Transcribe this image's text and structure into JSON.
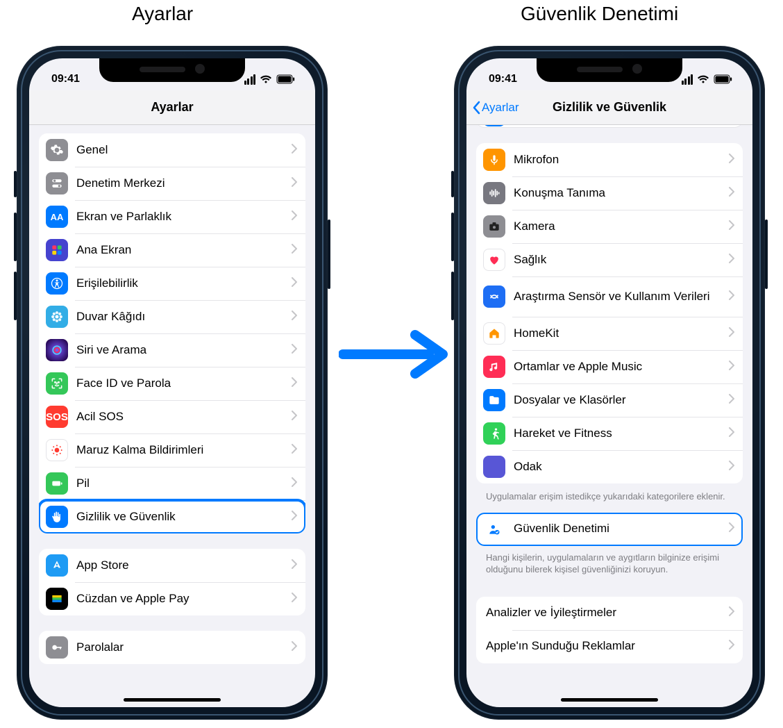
{
  "headings": {
    "left": "Ayarlar",
    "right": "Güvenlik Denetimi"
  },
  "status": {
    "time": "09:41"
  },
  "left_phone": {
    "nav_title": "Ayarlar",
    "group1": [
      {
        "key": "general",
        "label": "Genel"
      },
      {
        "key": "control-center",
        "label": "Denetim Merkezi"
      },
      {
        "key": "display",
        "label": "Ekran ve Parlaklık"
      },
      {
        "key": "home-screen",
        "label": "Ana Ekran"
      },
      {
        "key": "accessibility",
        "label": "Erişilebilirlik"
      },
      {
        "key": "wallpaper",
        "label": "Duvar Kâğıdı"
      },
      {
        "key": "siri",
        "label": "Siri ve Arama"
      },
      {
        "key": "faceid",
        "label": "Face ID ve Parola"
      },
      {
        "key": "sos",
        "label": "Acil SOS"
      },
      {
        "key": "exposure",
        "label": "Maruz Kalma Bildirimleri"
      },
      {
        "key": "battery",
        "label": "Pil"
      },
      {
        "key": "privacy",
        "label": "Gizlilik ve Güvenlik"
      }
    ],
    "group2": [
      {
        "key": "appstore",
        "label": "App Store"
      },
      {
        "key": "wallet",
        "label": "Cüzdan ve Apple Pay"
      }
    ],
    "group3": [
      {
        "key": "passwords",
        "label": "Parolalar"
      }
    ]
  },
  "right_phone": {
    "back_label": "Ayarlar",
    "nav_title": "Gizlilik ve Güvenlik",
    "group_top": [
      {
        "key": "microphone",
        "label": "Mikrofon"
      },
      {
        "key": "speech",
        "label": "Konuşma Tanıma"
      },
      {
        "key": "camera",
        "label": "Kamera"
      },
      {
        "key": "health",
        "label": "Sağlık"
      },
      {
        "key": "research",
        "label": "Araştırma Sensör ve Kullanım Verileri"
      },
      {
        "key": "homekit",
        "label": "HomeKit"
      },
      {
        "key": "media",
        "label": "Ortamlar ve Apple Music"
      },
      {
        "key": "files",
        "label": "Dosyalar ve Klasörler"
      },
      {
        "key": "fitness",
        "label": "Hareket ve Fitness"
      },
      {
        "key": "focus",
        "label": "Odak"
      }
    ],
    "footer1": "Uygulamalar erişim istedikçe yukarıdaki kategorilere eklenir.",
    "safety_check": {
      "label": "Güvenlik Denetimi"
    },
    "footer2": "Hangi kişilerin, uygulamaların ve aygıtların bilginize erişimi olduğunu bilerek kişisel güvenliğinizi koruyun.",
    "group_bottom": [
      {
        "key": "analytics",
        "label": "Analizler ve İyileştirmeler"
      },
      {
        "key": "apple-ads",
        "label": "Apple'ın Sunduğu Reklamlar"
      }
    ]
  }
}
